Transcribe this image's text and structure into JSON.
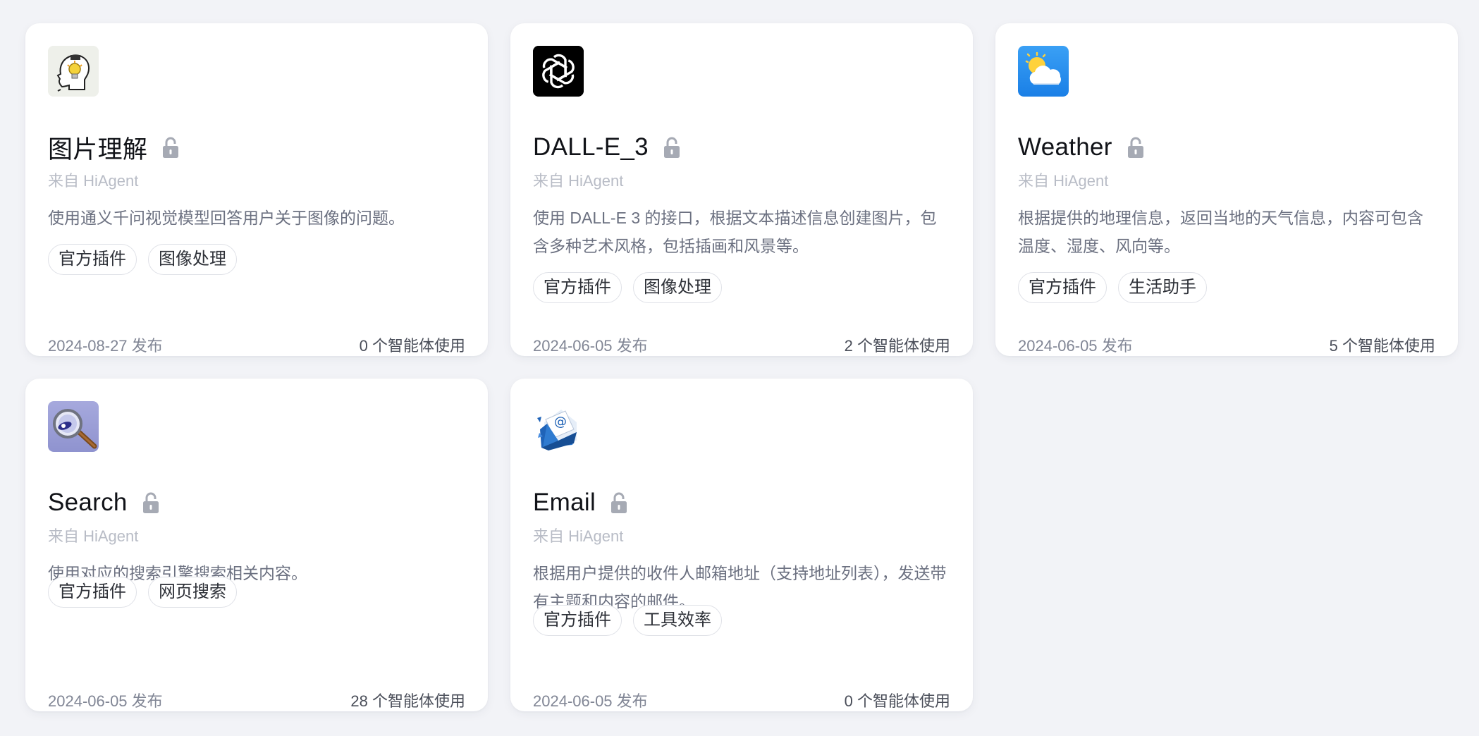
{
  "colors": {
    "background": "#f2f3f7",
    "card": "#ffffff",
    "title": "#111318",
    "source": "#b8bcc6",
    "description": "#6b7080",
    "tag_border": "#dfe1e7"
  },
  "plugins": [
    {
      "icon": "lightbulb-head-icon",
      "title": "图片理解",
      "source": "来自 HiAgent",
      "description": "使用通义千问视觉模型回答用户关于图像的问题。",
      "tags": [
        "官方插件",
        "图像处理"
      ],
      "published": "2024-08-27 发布",
      "usage": "0 个智能体使用"
    },
    {
      "icon": "openai-logo-icon",
      "title": "DALL-E_3",
      "source": "来自 HiAgent",
      "description": "使用 DALL-E 3 的接口，根据文本描述信息创建图片，包含多种艺术风格，包括插画和风景等。",
      "tags": [
        "官方插件",
        "图像处理"
      ],
      "published": "2024-06-05 发布",
      "usage": "2 个智能体使用"
    },
    {
      "icon": "weather-sun-cloud-icon",
      "title": "Weather",
      "source": "来自 HiAgent",
      "description": "根据提供的地理信息，返回当地的天气信息，内容可包含温度、湿度、风向等。",
      "tags": [
        "官方插件",
        "生活助手"
      ],
      "published": "2024-06-05 发布",
      "usage": "5 个智能体使用"
    },
    {
      "icon": "magnifier-search-icon",
      "title": "Search",
      "source": "来自 HiAgent",
      "description": "使用对应的搜索引擎搜索相关内容。",
      "tags": [
        "官方插件",
        "网页搜索"
      ],
      "published": "2024-06-05 发布",
      "usage": "28 个智能体使用"
    },
    {
      "icon": "email-envelope-icon",
      "title": "Email",
      "source": "来自 HiAgent",
      "description": "根据用户提供的收件人邮箱地址（支持地址列表），发送带有主题和内容的邮件。",
      "tags": [
        "官方插件",
        "工具效率"
      ],
      "published": "2024-06-05 发布",
      "usage": "0 个智能体使用"
    }
  ]
}
